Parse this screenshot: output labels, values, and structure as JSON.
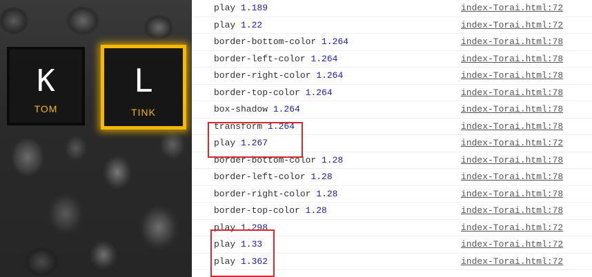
{
  "keys": [
    {
      "letter": "K",
      "sound": "TOM",
      "state": "idle"
    },
    {
      "letter": "L",
      "sound": "TINK",
      "state": "playing",
      "accent_color": "#f5b800"
    }
  ],
  "console": {
    "rows": [
      {
        "name": "play",
        "value": "1.189",
        "source": "index-Torai.html:72"
      },
      {
        "name": "play",
        "value": "1.22",
        "source": "index-Torai.html:72"
      },
      {
        "name": "border-bottom-color",
        "value": "1.264",
        "source": "index-Torai.html:78"
      },
      {
        "name": "border-left-color",
        "value": "1.264",
        "source": "index-Torai.html:78"
      },
      {
        "name": "border-right-color",
        "value": "1.264",
        "source": "index-Torai.html:78"
      },
      {
        "name": "border-top-color",
        "value": "1.264",
        "source": "index-Torai.html:78"
      },
      {
        "name": "box-shadow",
        "value": "1.264",
        "source": "index-Torai.html:78"
      },
      {
        "name": "transform",
        "value": "1.264",
        "source": "index-Torai.html:78"
      },
      {
        "name": "play",
        "value": "1.267",
        "source": "index-Torai.html:72"
      },
      {
        "name": "border-bottom-color",
        "value": "1.28",
        "source": "index-Torai.html:78"
      },
      {
        "name": "border-left-color",
        "value": "1.28",
        "source": "index-Torai.html:78"
      },
      {
        "name": "border-right-color",
        "value": "1.28",
        "source": "index-Torai.html:78"
      },
      {
        "name": "border-top-color",
        "value": "1.28",
        "source": "index-Torai.html:78"
      },
      {
        "name": "play",
        "value": "1.298",
        "source": "index-Torai.html:72"
      },
      {
        "name": "play",
        "value": "1.33",
        "source": "index-Torai.html:72"
      },
      {
        "name": "play",
        "value": "1.362",
        "source": "index-Torai.html:72"
      }
    ],
    "colors": {
      "value": "#1a1aa6",
      "highlight": "#d9272e"
    }
  }
}
